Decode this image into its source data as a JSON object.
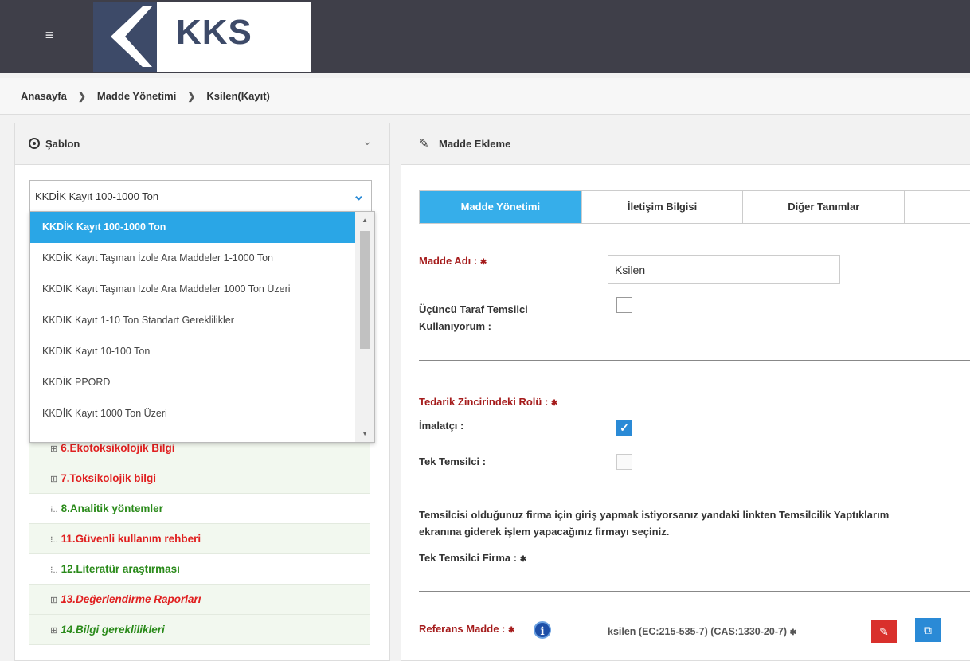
{
  "app": {
    "logo_text": "KKS"
  },
  "breadcrumb": {
    "items": [
      "Anasayfa",
      "Madde Yönetimi",
      "Ksilen(Kayıt)"
    ]
  },
  "left_panel": {
    "title": "Şablon",
    "select_value": "KKDİK Kayıt 100-1000 Ton",
    "options": [
      "KKDİK Kayıt 100-1000 Ton",
      "KKDİK Kayıt Taşınan İzole Ara Maddeler 1-1000 Ton",
      "KKDİK Kayıt Taşınan İzole Ara Maddeler 1000 Ton Üzeri",
      "KKDİK Kayıt 1-10 Ton Standart Gereklilikler",
      "KKDİK Kayıt 10-100 Ton",
      "KKDİK PPORD",
      "KKDİK Kayıt 1000 Ton Üzeri"
    ],
    "tree": [
      {
        "label": "6.Ekotoksikolojik Bilgi",
        "color": "red",
        "prefix": "⊞"
      },
      {
        "label": "7.Toksikolojik bilgi",
        "color": "red",
        "prefix": "⊞"
      },
      {
        "label": "8.Analitik yöntemler",
        "color": "green",
        "prefix": "ⵗ"
      },
      {
        "label": "11.Güvenli kullanım rehberi",
        "color": "red",
        "prefix": "ⵗ"
      },
      {
        "label": "12.Literatür araştırması",
        "color": "green",
        "prefix": "ⵗ"
      },
      {
        "label": "13.Değerlendirme Raporları",
        "color": "red",
        "prefix": "⊞"
      },
      {
        "label": "14.Bilgi gereklilikleri",
        "color": "green",
        "prefix": "⊞"
      }
    ]
  },
  "right_panel": {
    "title": "Madde Ekleme",
    "tabs": [
      "Madde Yönetimi",
      "İletişim Bilgisi",
      "Diğer Tanımlar",
      ""
    ],
    "madde_adi_label": "Madde Adı :",
    "madde_adi_value": "Ksilen",
    "ucuncu_label_1": "Üçüncü Taraf Temsilci",
    "ucuncu_label_2": "Kullanıyorum :",
    "tedarik_label": "Tedarik Zincirindeki Rolü :",
    "imalatci_label": "İmalatçı :",
    "tek_temsilci_label": "Tek Temsilci :",
    "info_line_1": "Temsilcisi olduğunuz firma için giriş yapmak istiyorsanız yandaki linkten Temsilcilik Yaptıklarım",
    "info_line_2": "ekranına giderek işlem yapacağınız firmayı seçiniz.",
    "tek_temsilci_firma_label": "Tek Temsilci Firma :",
    "referans_label": "Referans Madde :",
    "referans_value": "ksilen (EC:215-535-7) (CAS:1330-20-7)"
  }
}
